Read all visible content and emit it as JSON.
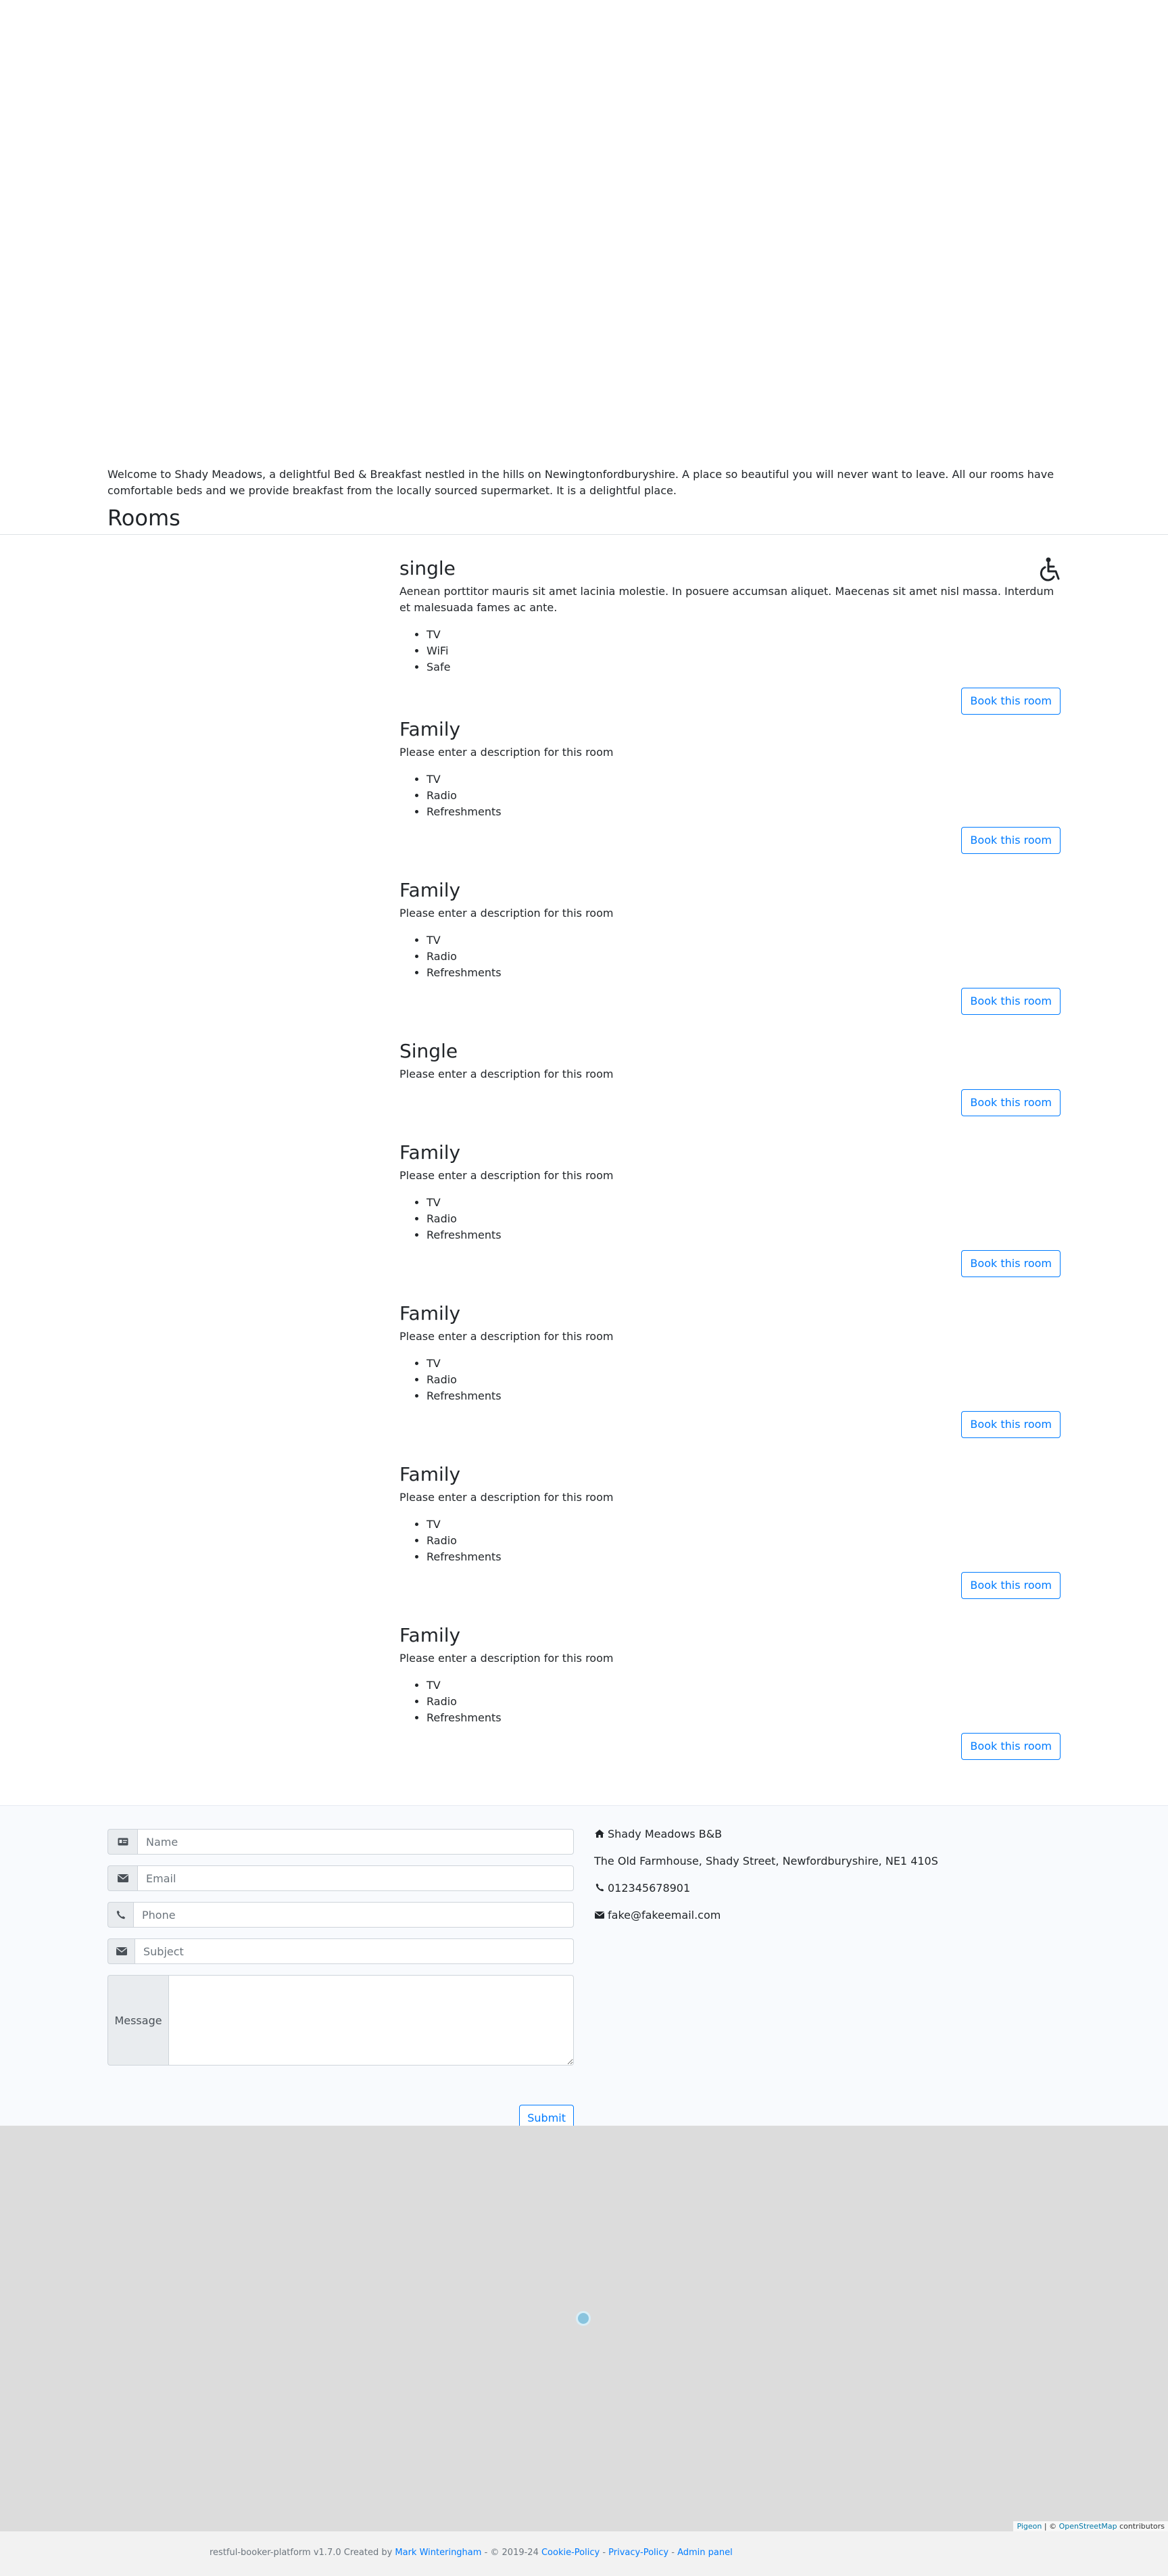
{
  "welcome": {
    "text": "Welcome to Shady Meadows, a delightful Bed & Breakfast nestled in the hills on Newingtonfordburyshire. A place so beautiful you will never want to leave. All our rooms have comfortable beds and we provide breakfast from the locally sourced supermarket. It is a delightful place."
  },
  "rooms_heading": "Rooms",
  "book_label": "Book this room",
  "rooms": [
    {
      "title": "single",
      "description": "Aenean porttitor mauris sit amet lacinia molestie. In posuere accumsan aliquet. Maecenas sit amet nisl massa. Interdum et malesuada fames ac ante.",
      "amenities": [
        "TV",
        "WiFi",
        "Safe"
      ],
      "accessible": true
    },
    {
      "title": "Family",
      "description": "Please enter a description for this room",
      "amenities": [
        "TV",
        "Radio",
        "Refreshments"
      ]
    },
    {
      "title": "Family",
      "description": "Please enter a description for this room",
      "amenities": [
        "TV",
        "Radio",
        "Refreshments"
      ]
    },
    {
      "title": "Single",
      "description": "Please enter a description for this room",
      "amenities": []
    },
    {
      "title": "Family",
      "description": "Please enter a description for this room",
      "amenities": [
        "TV",
        "Radio",
        "Refreshments"
      ]
    },
    {
      "title": "Family",
      "description": "Please enter a description for this room",
      "amenities": [
        "TV",
        "Radio",
        "Refreshments"
      ]
    },
    {
      "title": "Family",
      "description": "Please enter a description for this room",
      "amenities": [
        "TV",
        "Radio",
        "Refreshments"
      ]
    },
    {
      "title": "Family",
      "description": "Please enter a description for this room",
      "amenities": [
        "TV",
        "Radio",
        "Refreshments"
      ]
    }
  ],
  "contact_form": {
    "name_placeholder": "Name",
    "email_placeholder": "Email",
    "phone_placeholder": "Phone",
    "subject_placeholder": "Subject",
    "message_label": "Message",
    "submit_label": "Submit"
  },
  "contact_info": {
    "name": "Shady Meadows B&B",
    "address": "The Old Farmhouse, Shady Street, Newfordburyshire, NE1 410S",
    "phone": "012345678901",
    "email": "fake@fakeemail.com"
  },
  "map": {
    "attribution_pigeon": "Pigeon",
    "attribution_sep": " | © ",
    "attribution_osm": "OpenStreetMap",
    "attribution_suffix": " contributors"
  },
  "footer": {
    "prefix": "restful-booker-platform v1.7.0 Created by ",
    "author": "Mark Winteringham",
    "copyright": " - © 2019-24 ",
    "cookie": "Cookie-Policy",
    "sep1": " - ",
    "privacy": "Privacy-Policy",
    "sep2": " - ",
    "admin": "Admin panel"
  },
  "icons": {
    "name": "id-card-icon",
    "email": "envelope-icon",
    "phone": "phone-icon",
    "subject": "envelope-icon",
    "home": "home-icon",
    "accessible": "wheelchair-icon"
  },
  "colors": {
    "primary": "#007bff",
    "contact_bg": "#f8fafd",
    "map_bg": "#dcdcdc",
    "footer_bg": "#f2f2f2"
  }
}
